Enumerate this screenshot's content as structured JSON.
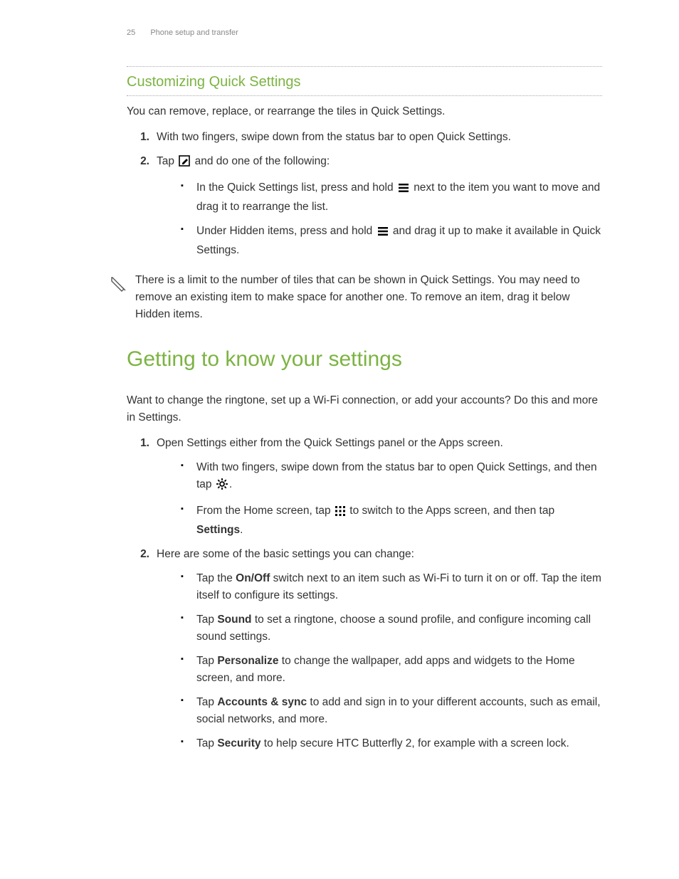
{
  "header": {
    "page_number": "25",
    "breadcrumb": "Phone setup and transfer"
  },
  "section1": {
    "title": "Customizing Quick Settings",
    "intro": "You can remove, replace, or rearrange the tiles in Quick Settings.",
    "step1": "With two fingers, swipe down from the status bar to open Quick Settings.",
    "step2_pre": "Tap ",
    "step2_post": " and do one of the following:",
    "sub1_pre": "In the Quick Settings list, press and hold ",
    "sub1_post": " next to the item you want to move and drag it to rearrange the list.",
    "sub2_pre": "Under Hidden items, press and hold ",
    "sub2_post": " and drag it up to make it available in Quick Settings.",
    "note": "There is a limit to the number of tiles that can be shown in Quick Settings. You may need to remove an existing item to make space for another one. To remove an item, drag it below Hidden items."
  },
  "section2": {
    "title": "Getting to know your settings",
    "intro": "Want to change the ringtone, set up a Wi-Fi connection, or add your accounts? Do this and more in Settings.",
    "step1": "Open Settings either from the Quick Settings panel or the Apps screen.",
    "s1_sub1_pre": "With two fingers, swipe down from the status bar to open Quick Settings, and then tap ",
    "s1_sub1_post": ".",
    "s1_sub2_pre": "From the Home screen, tap ",
    "s1_sub2_mid": " to switch to the Apps screen, and then tap ",
    "s1_sub2_bold": "Settings",
    "s1_sub2_post": ".",
    "step2": "Here are some of the basic settings you can change:",
    "s2_sub1_pre": "Tap the ",
    "s2_sub1_bold": "On/Off",
    "s2_sub1_post": " switch next to an item such as Wi-Fi to turn it on or off. Tap the item itself to configure its settings.",
    "s2_sub2_pre": "Tap ",
    "s2_sub2_bold": "Sound",
    "s2_sub2_post": " to set a ringtone, choose a sound profile, and configure incoming call sound settings.",
    "s2_sub3_pre": "Tap ",
    "s2_sub3_bold": "Personalize",
    "s2_sub3_post": " to change the wallpaper, add apps and widgets to the Home screen, and more.",
    "s2_sub4_pre": "Tap ",
    "s2_sub4_bold": "Accounts & sync",
    "s2_sub4_post": " to add and sign in to your different accounts, such as email, social networks, and more.",
    "s2_sub5_pre": "Tap ",
    "s2_sub5_bold": "Security",
    "s2_sub5_post": " to help secure HTC Butterfly 2, for example with a screen lock."
  },
  "numbers": {
    "one": "1.",
    "two": "2."
  }
}
